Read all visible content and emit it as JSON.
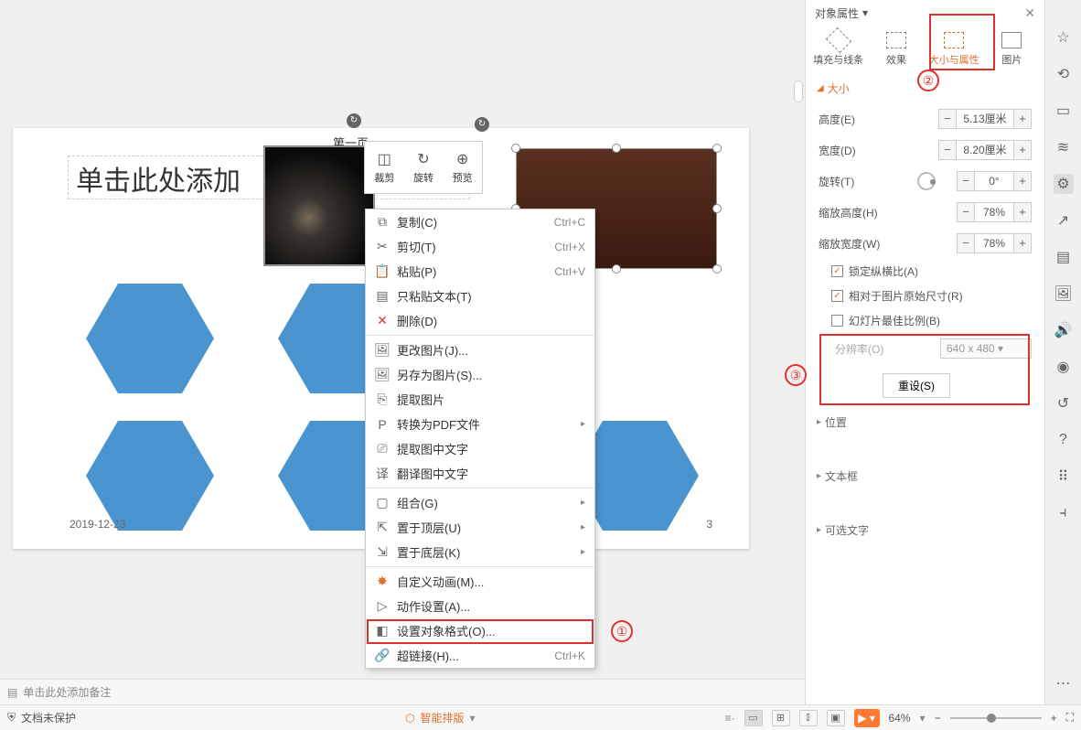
{
  "slide": {
    "title_placeholder": "单击此处添加",
    "page_label": "第一页",
    "date": "2019-12-23",
    "page_num": "3"
  },
  "mini_toolbar": {
    "crop": "裁剪",
    "rotate": "旋转",
    "preview": "预览"
  },
  "context_menu": {
    "copy": {
      "label": "复制(C)",
      "sc": "Ctrl+C"
    },
    "cut": {
      "label": "剪切(T)",
      "sc": "Ctrl+X"
    },
    "paste": {
      "label": "粘贴(P)",
      "sc": "Ctrl+V"
    },
    "paste_text": "只粘贴文本(T)",
    "delete": "删除(D)",
    "change_pic": "更改图片(J)...",
    "save_as_pic": "另存为图片(S)...",
    "extract_pic": "提取图片",
    "to_pdf": "转换为PDF文件",
    "ocr": "提取图中文字",
    "translate": "翻译图中文字",
    "group": "组合(G)",
    "bring_top": "置于顶层(U)",
    "send_bottom": "置于底层(K)",
    "custom_anim": "自定义动画(M)...",
    "action": "动作设置(A)...",
    "format_obj": "设置对象格式(O)...",
    "hyperlink": {
      "label": "超链接(H)...",
      "sc": "Ctrl+K"
    }
  },
  "panel": {
    "title": "对象属性",
    "tabs": {
      "fill": "填充与线条",
      "effects": "效果",
      "size": "大小与属性",
      "picture": "图片"
    },
    "sections": {
      "size": "大小",
      "position": "位置",
      "textbox": "文本框",
      "alt_text": "可选文字"
    },
    "props": {
      "height": {
        "label": "高度(E)",
        "value": "5.13厘米"
      },
      "width": {
        "label": "宽度(D)",
        "value": "8.20厘米"
      },
      "rotation": {
        "label": "旋转(T)",
        "value": "0°"
      },
      "scale_h": {
        "label": "缩放高度(H)",
        "value": "78%"
      },
      "scale_w": {
        "label": "缩放宽度(W)",
        "value": "78%"
      },
      "resolution": {
        "label": "分辨率(O)",
        "value": "640 x 480"
      }
    },
    "checks": {
      "lock_ratio": "锁定纵横比(A)",
      "relative_orig": "相对于图片原始尺寸(R)",
      "best_scale": "幻灯片最佳比例(B)"
    },
    "reset": "重设(S)"
  },
  "notes": {
    "placeholder": "单击此处添加备注"
  },
  "status": {
    "protect": "文档未保护",
    "smart_layout": "智能排版",
    "zoom": "64%"
  },
  "annotations": {
    "n1": "①",
    "n2": "②",
    "n3": "③"
  },
  "chart_data": null
}
